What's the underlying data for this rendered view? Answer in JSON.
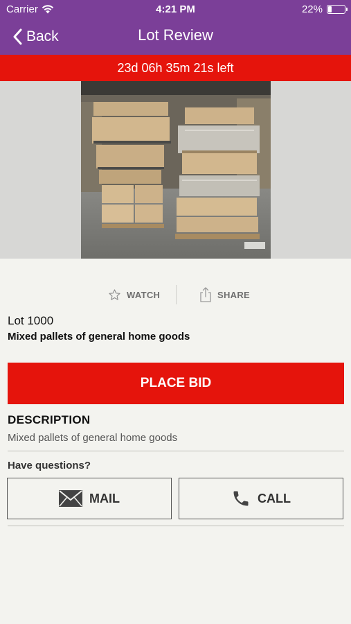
{
  "status_bar": {
    "carrier": "Carrier",
    "time": "4:21 PM",
    "battery": "22%",
    "battery_level": 0.22
  },
  "nav": {
    "back_label": "Back",
    "title": "Lot Review"
  },
  "countdown": "23d 06h 35m 21s left",
  "actions": {
    "watch_label": "WATCH",
    "share_label": "SHARE"
  },
  "lot": {
    "number": "Lot 1000",
    "title": "Mixed pallets of general home goods"
  },
  "place_bid_label": "PLACE BID",
  "description": {
    "heading": "DESCRIPTION",
    "text": "Mixed pallets of general home goods"
  },
  "questions_label": "Have questions?",
  "contact": {
    "mail_label": "MAIL",
    "call_label": "CALL"
  },
  "colors": {
    "brand_purple": "#7b3f98",
    "alert_red": "#e5140c",
    "background": "#f3f3ef"
  },
  "icons": {
    "back": "chevron-left-icon",
    "wifi": "wifi-icon",
    "battery": "battery-icon",
    "watch": "star-outline-icon",
    "share": "share-icon",
    "mail": "envelope-icon",
    "call": "phone-icon"
  }
}
